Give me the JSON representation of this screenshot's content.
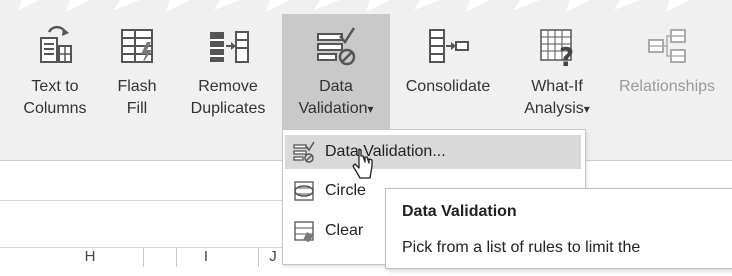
{
  "ribbon": {
    "buttons": [
      {
        "line1": "Text to",
        "line2": "Columns",
        "icon": "text-to-columns-icon"
      },
      {
        "line1": "Flash",
        "line2": "Fill",
        "icon": "flash-fill-icon"
      },
      {
        "line1": "Remove",
        "line2": "Duplicates",
        "icon": "remove-duplicates-icon"
      },
      {
        "line1": "Data",
        "line2": "Validation",
        "caret": "▾",
        "icon": "data-validation-icon"
      },
      {
        "line1": "Consolidate",
        "line2": "",
        "icon": "consolidate-icon"
      },
      {
        "line1": "What-If",
        "line2": "Analysis",
        "caret": "▾",
        "icon": "what-if-analysis-icon"
      },
      {
        "line1": "Relationships",
        "line2": "",
        "icon": "relationships-icon"
      }
    ]
  },
  "menu": {
    "items": [
      {
        "label": "Data Validation...",
        "icon": "data-validation-small-icon"
      },
      {
        "label": "Circle",
        "icon": "circle-invalid-icon"
      },
      {
        "label": "Clear",
        "icon": "clear-circles-icon"
      }
    ]
  },
  "tooltip": {
    "title": "Data Validation",
    "body": "Pick from a list of rules to limit the"
  },
  "columns": [
    "H",
    "I",
    "J"
  ],
  "colors": {
    "ribbon_bg": "#f0f0f0",
    "active_bg": "#c9c9c9",
    "menu_highlight": "#d9d9d9",
    "disabled_text": "#9a9a9a"
  }
}
